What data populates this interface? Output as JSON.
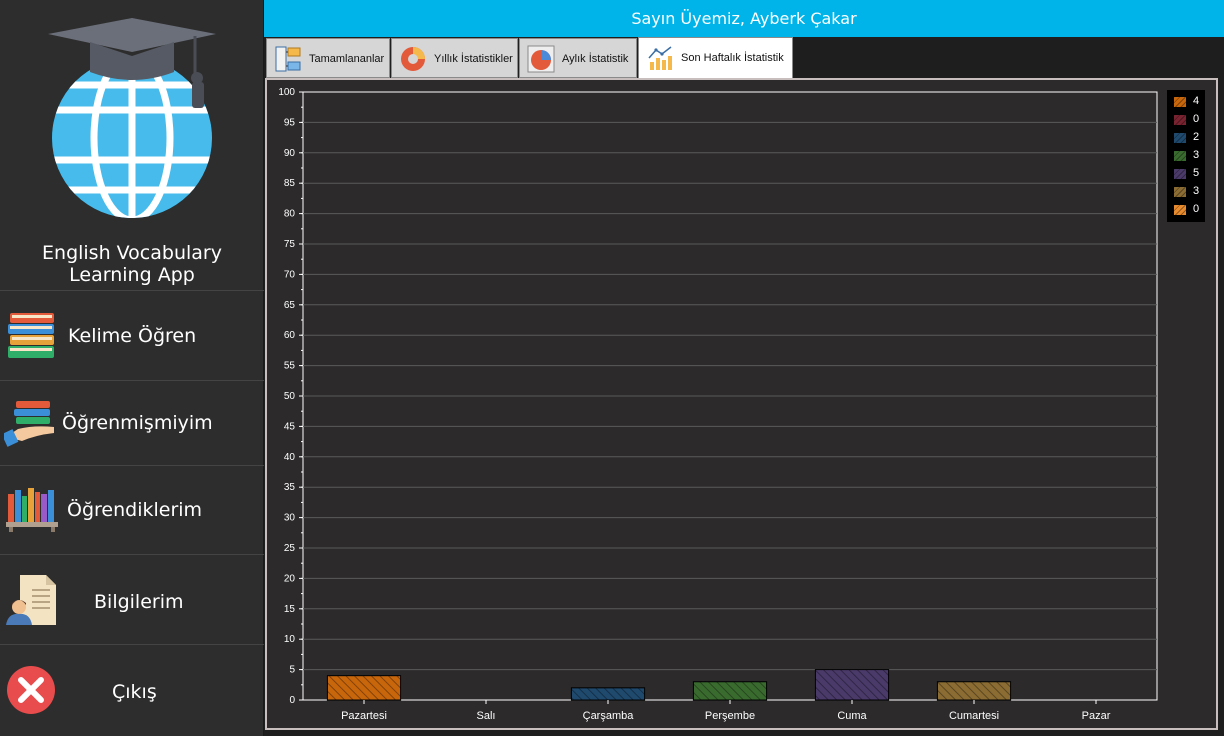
{
  "header": {
    "greeting": "Sayın Üyemiz, Ayberk Çakar"
  },
  "sidebar": {
    "app_title_line1": "English Vocabulary",
    "app_title_line2": "Learning App",
    "items": [
      {
        "label": "Kelime Öğren",
        "icon": "books-stack-icon"
      },
      {
        "label": "Öğrenmişmiyim",
        "icon": "hand-books-icon"
      },
      {
        "label": "Öğrendiklerim",
        "icon": "bookshelf-icon"
      },
      {
        "label": "Bilgilerim",
        "icon": "profile-document-icon"
      },
      {
        "label": "Çıkış",
        "icon": "close-icon"
      }
    ]
  },
  "tabs": [
    {
      "label": "Tamamlananlar",
      "icon": "diagram-icon"
    },
    {
      "label": "Yıllık İstatistikler",
      "icon": "donut-chart-icon"
    },
    {
      "label": "Aylık İstatistik",
      "icon": "pie-chart-icon"
    },
    {
      "label": "Son Haftalık İstatistik",
      "icon": "line-bar-chart-icon",
      "active": true
    }
  ],
  "colors": {
    "header": "#00b4ea",
    "series": [
      "#c8660c",
      "#7a2330",
      "#1f4a6e",
      "#3a6b2e",
      "#4a3a6a",
      "#8b6c32",
      "#e88a2e"
    ]
  },
  "chart_data": {
    "type": "bar",
    "categories": [
      "Pazartesi",
      "Salı",
      "Çarşamba",
      "Perşembe",
      "Cuma",
      "Cumartesi",
      "Pazar"
    ],
    "values": [
      4,
      0,
      2,
      3,
      5,
      3,
      0
    ],
    "ylim": [
      0,
      100
    ],
    "yticks": [
      0,
      5,
      10,
      15,
      20,
      25,
      30,
      35,
      40,
      45,
      50,
      55,
      60,
      65,
      70,
      75,
      80,
      85,
      90,
      95,
      100
    ],
    "legend": [
      "4",
      "0",
      "2",
      "3",
      "5",
      "3",
      "0"
    ],
    "legend_position": "top-right",
    "grid": true
  }
}
